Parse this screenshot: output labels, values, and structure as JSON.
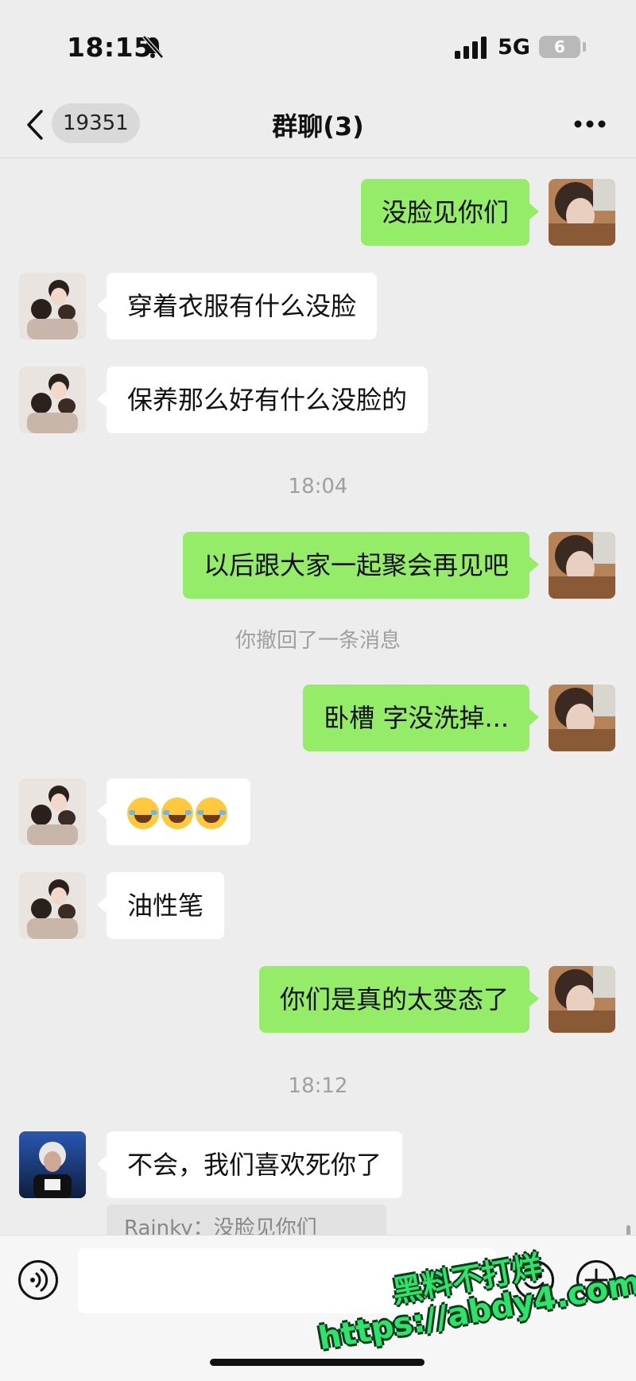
{
  "status_bar": {
    "time": "18:15",
    "network": "5G",
    "battery": "6"
  },
  "nav": {
    "unread_count": "19351",
    "title": "群聊(3)"
  },
  "messages": [
    {
      "side": "me",
      "text": "没脸见你们"
    },
    {
      "side": "other",
      "text": "穿着衣服有什么没脸"
    },
    {
      "side": "other",
      "text": "保养那么好有什么没脸的"
    },
    {
      "type": "timestamp",
      "text": "18:04"
    },
    {
      "side": "me",
      "text": "以后跟大家一起聚会再见吧"
    },
    {
      "type": "system",
      "text": "你撤回了一条消息"
    },
    {
      "side": "me",
      "text": "卧槽 字没洗掉..."
    },
    {
      "side": "other",
      "emoji": "joy-tears-x3"
    },
    {
      "side": "other",
      "text": "油性笔"
    },
    {
      "side": "me",
      "text": "你们是真的太变态了"
    },
    {
      "type": "timestamp",
      "text": "18:12"
    },
    {
      "side": "other",
      "text": "不会，我们喜欢死你了"
    }
  ],
  "quote_preview": "Rainky：没脸见你们",
  "watermark": {
    "line1": "黑料不打烊",
    "line2": "https://abdy4.com"
  }
}
